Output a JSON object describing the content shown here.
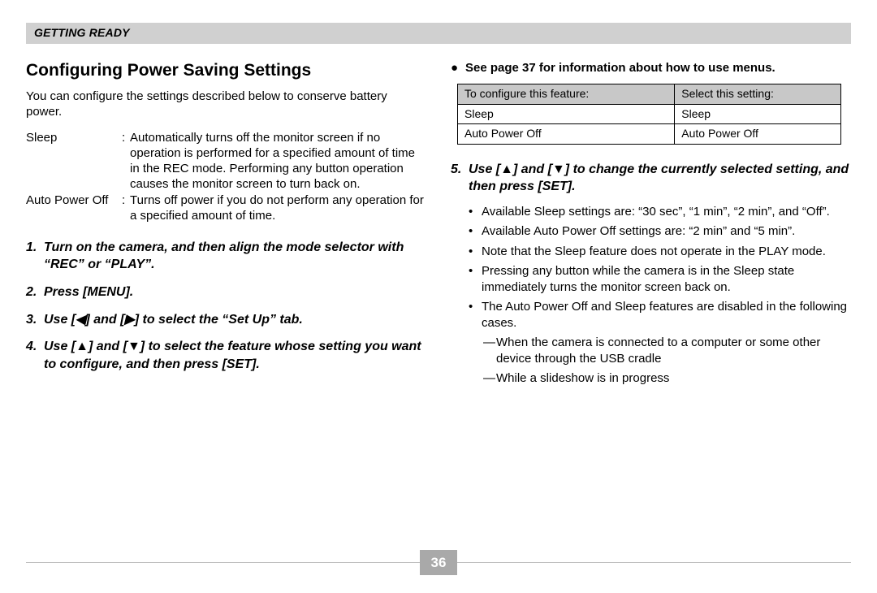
{
  "section_header": "GETTING READY",
  "title": "Configuring Power Saving Settings",
  "intro": "You can configure the settings described below to conserve battery power.",
  "definitions": [
    {
      "term": "Sleep",
      "body": "Automatically turns off the monitor screen if no operation is performed for a specified amount of time in the REC mode. Performing any button operation causes the monitor screen to turn back on."
    },
    {
      "term": "Auto Power Off",
      "body": "Turns off power if you do not perform any operation for a specified amount of time."
    }
  ],
  "steps_left": [
    {
      "n": "1.",
      "text": "Turn on the camera, and then align the mode selector with “REC” or “PLAY”."
    },
    {
      "n": "2.",
      "text": "Press [MENU]."
    },
    {
      "n": "3.",
      "text": "Use [◀] and [▶] to select the “Set Up” tab."
    },
    {
      "n": "4.",
      "text": "Use [▲] and [▼] to select the feature whose setting you want to configure, and then press [SET]."
    }
  ],
  "right_note": "See page 37 for information about how to use menus.",
  "table": {
    "headers": [
      "To configure this feature:",
      "Select this setting:"
    ],
    "rows": [
      [
        "Sleep",
        "Sleep"
      ],
      [
        "Auto Power Off",
        "Auto Power Off"
      ]
    ]
  },
  "step5": {
    "n": "5.",
    "text": "Use [▲] and [▼] to change the currently selected setting, and then press [SET]."
  },
  "bullets": [
    "Available Sleep settings are: “30 sec”, “1 min”, “2 min”, and “Off”.",
    "Available Auto Power Off settings are: “2 min” and “5 min”.",
    "Note that the Sleep feature does not operate in the PLAY mode.",
    "Pressing any button while the camera is in the Sleep state immediately turns the monitor screen back on.",
    "The Auto Power Off and Sleep features are disabled in the following cases."
  ],
  "sub_bullets": [
    "When the camera is connected to a computer or some other device through the USB cradle",
    "While a slideshow is in progress"
  ],
  "page_number": "36"
}
